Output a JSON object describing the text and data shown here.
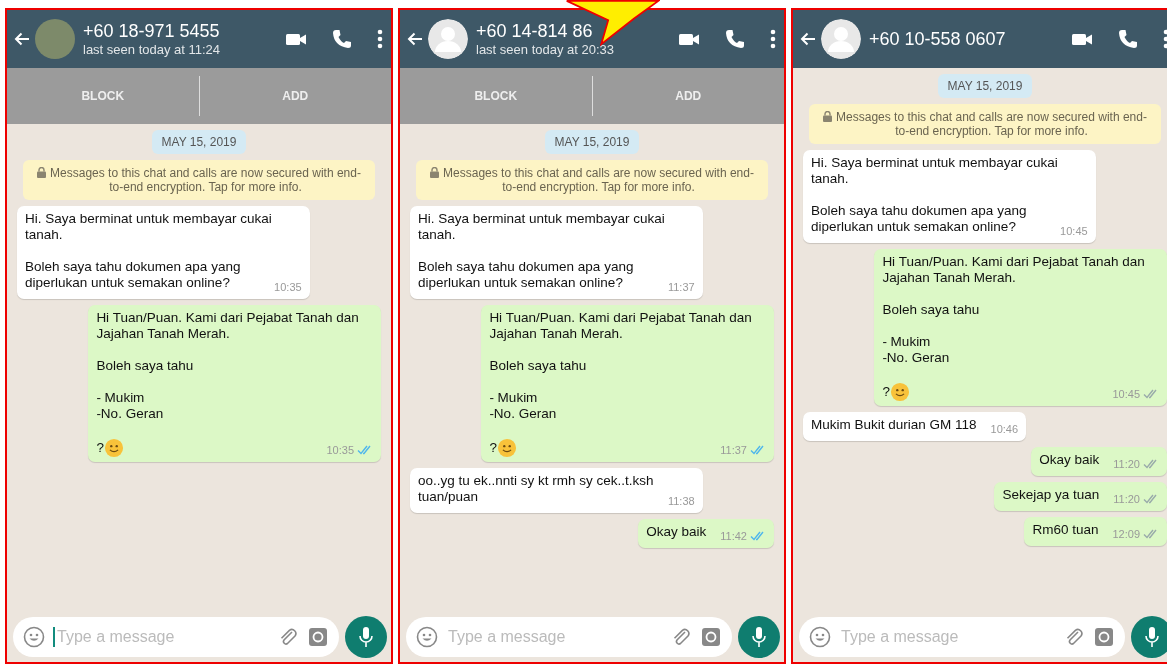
{
  "chats": [
    {
      "contact": {
        "name": "+60 18-971 5455",
        "status": "last seen today at 11:24",
        "avatar": {
          "kind": "photo"
        }
      },
      "actions": [
        "BLOCK",
        "ADD"
      ],
      "date": "MAY 15, 2019",
      "notice": "Messages to this chat and calls are now secured with end-to-end encryption. Tap for more info.",
      "messages": [
        {
          "kind": "in",
          "text": "Hi. Saya berminat untuk membayar cukai tanah.\n\nBoleh saya tahu dokumen apa yang diperlukan untuk semakan online?",
          "time": "10:35"
        },
        {
          "kind": "out",
          "text": "Hi Tuan/Puan. Kami dari Pejabat Tanah dan Jajahan Tanah Merah.\n\nBoleh saya tahu\n\n- Mukim\n-No. Geran\n\n?",
          "smiley": true,
          "time": "10:35",
          "read": true
        }
      ],
      "composer": {
        "placeholder": "Type a message",
        "cursor": true
      }
    },
    {
      "contact": {
        "name": "+60 14-814 86",
        "status": "last seen today at 20:33",
        "avatar": {
          "kind": "silhouette"
        }
      },
      "actions": [
        "BLOCK",
        "ADD"
      ],
      "date": "MAY 15, 2019",
      "notice": "Messages to this chat and calls are now secured with end-to-end encryption. Tap for more info.",
      "messages": [
        {
          "kind": "in",
          "text": "Hi. Saya berminat untuk membayar cukai tanah.\n\nBoleh saya tahu dokumen apa yang diperlukan untuk semakan online?",
          "time": "11:37"
        },
        {
          "kind": "out",
          "text": "Hi Tuan/Puan. Kami dari Pejabat Tanah dan Jajahan Tanah Merah.\n\nBoleh saya tahu\n\n- Mukim\n-No. Geran\n\n?",
          "smiley": true,
          "time": "11:37",
          "read": true
        },
        {
          "kind": "in",
          "text": "oo..yg tu ek..nnti sy kt rmh sy cek..t.ksh tuan/puan",
          "time": "11:38"
        },
        {
          "kind": "out",
          "text": "Okay baik",
          "time": "11:42",
          "read": true
        }
      ],
      "composer": {
        "placeholder": "Type a message",
        "cursor": false
      }
    },
    {
      "contact": {
        "name": "+60 10-558 0607",
        "avatar": {
          "kind": "silhouette"
        }
      },
      "date": "MAY 15, 2019",
      "notice": "Messages to this chat and calls are now secured with end-to-end encryption. Tap for more info.",
      "messages": [
        {
          "kind": "in",
          "text": "Hi. Saya berminat untuk membayar cukai tanah.\n\nBoleh saya tahu dokumen apa yang diperlukan untuk semakan online?",
          "time": "10:45"
        },
        {
          "kind": "out",
          "text": "Hi Tuan/Puan. Kami dari Pejabat Tanah dan Jajahan Tanah Merah.\n\nBoleh saya tahu\n\n- Mukim\n-No. Geran\n\n?",
          "smiley": true,
          "time": "10:45",
          "read": false
        },
        {
          "kind": "in",
          "text": "Mukim Bukit durian GM 118",
          "time": "10:46"
        },
        {
          "kind": "out",
          "text": "Okay baik",
          "time": "11:20",
          "read": false
        },
        {
          "kind": "out",
          "text": "Sekejap ya tuan",
          "time": "11:20",
          "read": false
        },
        {
          "kind": "out",
          "text": "Rm60 tuan",
          "time": "12:09",
          "read": false
        }
      ],
      "composer": {
        "placeholder": "Type a message",
        "cursor": false
      }
    }
  ]
}
